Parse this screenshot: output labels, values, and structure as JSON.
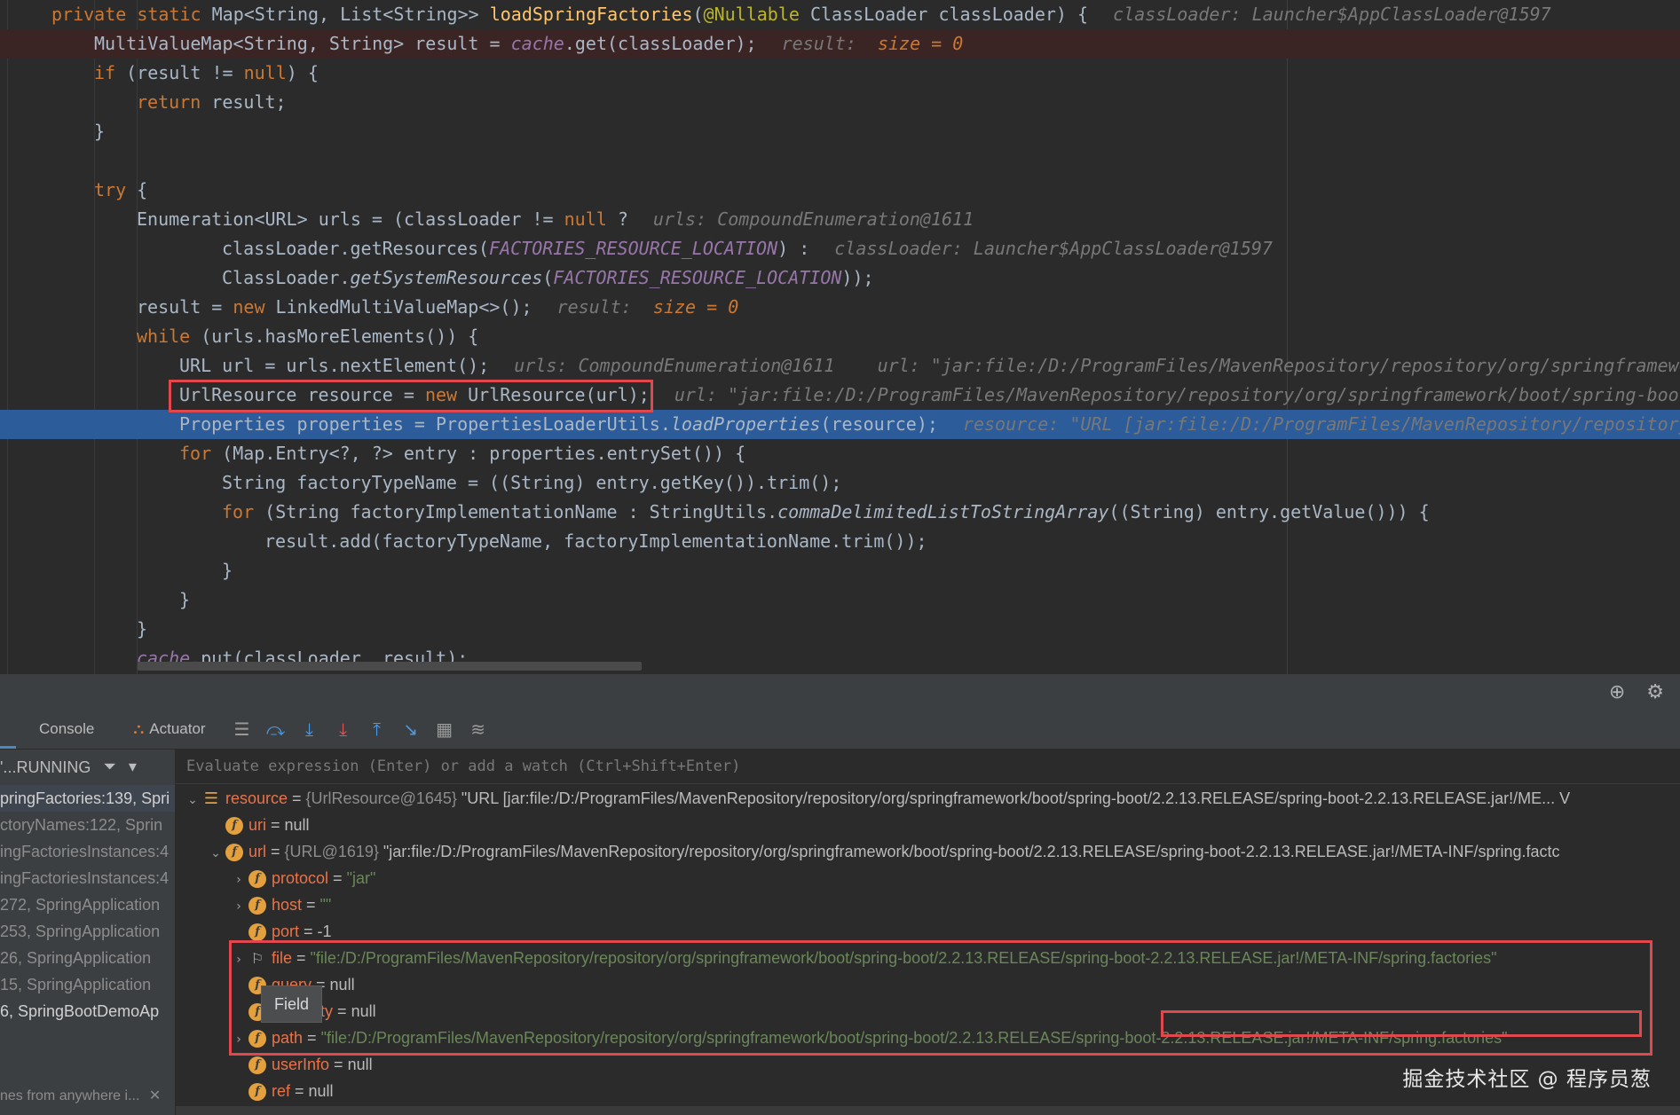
{
  "editor": {
    "lines": [
      {
        "segments": [
          [
            "kw",
            "private static "
          ],
          [
            "ty",
            "Map<String, List<String>> "
          ],
          [
            "fn",
            "loadSpringFactories"
          ],
          [
            "ty",
            "("
          ],
          [
            "an",
            "@Nullable "
          ],
          [
            "ty",
            "ClassLoader classLoader) {"
          ]
        ],
        "hint": "classLoader: Launcher$AppClassLoader@1597",
        "indent": 1
      },
      {
        "segments": [
          [
            "ty",
            "MultiValueMap<String, String> result = "
          ],
          [
            "st",
            "cache"
          ],
          [
            "ty",
            ".get(classLoader);"
          ]
        ],
        "hint": "result:  ",
        "hintVal": "size = 0",
        "indent": 2,
        "bp": true
      },
      {
        "segments": [
          [
            "kw",
            "if "
          ],
          [
            "ty",
            "(result != "
          ],
          [
            "kw",
            "null"
          ],
          [
            "ty",
            ") {"
          ]
        ],
        "indent": 2
      },
      {
        "segments": [
          [
            "kw",
            "return "
          ],
          [
            "ty",
            "result;"
          ]
        ],
        "indent": 3
      },
      {
        "segments": [
          [
            "ty",
            "}"
          ]
        ],
        "indent": 2
      },
      {
        "segments": [],
        "indent": 0
      },
      {
        "segments": [
          [
            "kw",
            "try "
          ],
          [
            "ty",
            "{"
          ]
        ],
        "indent": 2
      },
      {
        "segments": [
          [
            "ty",
            "Enumeration<URL> urls = (classLoader != "
          ],
          [
            "kw",
            "null "
          ],
          [
            "ty",
            "?"
          ]
        ],
        "hint": "urls: CompoundEnumeration@1611",
        "indent": 3
      },
      {
        "segments": [
          [
            "ty",
            "classLoader.getResources("
          ],
          [
            "st",
            "FACTORIES_RESOURCE_LOCATION"
          ],
          [
            "ty",
            ") :"
          ]
        ],
        "hint": "classLoader: Launcher$AppClassLoader@1597",
        "indent": 5
      },
      {
        "segments": [
          [
            "ty",
            "ClassLoader."
          ],
          [
            "it",
            "getSystemResources"
          ],
          [
            "ty",
            "("
          ],
          [
            "st",
            "FACTORIES_RESOURCE_LOCATION"
          ],
          [
            "ty",
            "));"
          ]
        ],
        "indent": 5
      },
      {
        "segments": [
          [
            "ty",
            "result = "
          ],
          [
            "kw",
            "new "
          ],
          [
            "ty",
            "LinkedMultiValueMap<>();"
          ]
        ],
        "hint": "result:  ",
        "hintVal": "size = 0",
        "indent": 3
      },
      {
        "segments": [
          [
            "kw",
            "while "
          ],
          [
            "ty",
            "(urls.hasMoreElements()) {"
          ]
        ],
        "indent": 3
      },
      {
        "segments": [
          [
            "ty",
            "URL url = urls.nextElement();"
          ]
        ],
        "hint": "urls: CompoundEnumeration@1611    url: \"jar:file:/D:/ProgramFiles/MavenRepository/repository/org/springframework",
        "indent": 4
      },
      {
        "segments": [
          [
            "ty",
            "UrlResource resource = "
          ],
          [
            "kw",
            "new "
          ],
          [
            "ty",
            "UrlResource(url);"
          ]
        ],
        "hint": "url: \"jar:file:/D:/ProgramFiles/MavenRepository/repository/org/springframework/boot/spring-boot",
        "indent": 4
      },
      {
        "segments": [
          [
            "ty",
            "Properties properties = PropertiesLoaderUtils."
          ],
          [
            "it",
            "loadProperties"
          ],
          [
            "ty",
            "(resource);"
          ]
        ],
        "hint": "resource: \"URL [jar:file:/D:/ProgramFiles/MavenRepository/repository",
        "indent": 4,
        "cur": true
      },
      {
        "segments": [
          [
            "kw",
            "for "
          ],
          [
            "ty",
            "(Map.Entry<?, ?> entry : properties.entrySet()) {"
          ]
        ],
        "indent": 4
      },
      {
        "segments": [
          [
            "ty",
            "String factoryTypeName = ((String) entry.getKey()).trim();"
          ]
        ],
        "indent": 5
      },
      {
        "segments": [
          [
            "kw",
            "for "
          ],
          [
            "ty",
            "(String factoryImplementationName : StringUtils."
          ],
          [
            "it",
            "commaDelimitedListToStringArray"
          ],
          [
            "ty",
            "((String) entry.getValue())) {"
          ]
        ],
        "indent": 5
      },
      {
        "segments": [
          [
            "ty",
            "result.add(factoryTypeName, factoryImplementationName.trim());"
          ]
        ],
        "indent": 6
      },
      {
        "segments": [
          [
            "ty",
            "}"
          ]
        ],
        "indent": 5
      },
      {
        "segments": [
          [
            "ty",
            "}"
          ]
        ],
        "indent": 4
      },
      {
        "segments": [
          [
            "ty",
            "}"
          ]
        ],
        "indent": 3
      },
      {
        "segments": [
          [
            "st",
            "cache"
          ],
          [
            "ty",
            ".put(classLoader, result);"
          ]
        ],
        "indent": 3
      }
    ]
  },
  "debug": {
    "tabs": {
      "console": "Console",
      "actuator": "Actuator"
    },
    "frames_header": "'...RUNNING",
    "frames": [
      "pringFactories:139, Spri",
      "ctoryNames:122, Sprin",
      "ingFactoriesInstances:4",
      "ingFactoriesInstances:4",
      "272, SpringApplication",
      "253, SpringApplication",
      "26, SpringApplication",
      "15, SpringApplication",
      "6, SpringBootDemoAp"
    ],
    "frames_footer": "nes from anywhere i...",
    "eval_placeholder": "Evaluate expression (Enter) or add a watch (Ctrl+Shift+Enter)",
    "variables": [
      {
        "arrow": "v",
        "icon": "list",
        "name": "resource",
        "type": "{UrlResource@1645} ",
        "value": "\"URL [jar:file:/D:/ProgramFiles/MavenRepository/repository/org/springframework/boot/spring-boot/2.2.13.RELEASE/spring-boot-2.2.13.RELEASE.jar!/ME... V",
        "kind": "plain",
        "depth": 0
      },
      {
        "arrow": "",
        "icon": "f",
        "name": "uri",
        "type": "",
        "value": "null",
        "kind": "plain",
        "depth": 1
      },
      {
        "arrow": "v",
        "icon": "f",
        "name": "url",
        "type": "{URL@1619} ",
        "value": "\"jar:file:/D:/ProgramFiles/MavenRepository/repository/org/springframework/boot/spring-boot/2.2.13.RELEASE/spring-boot-2.2.13.RELEASE.jar!/META-INF/spring.factc",
        "kind": "plain",
        "depth": 1
      },
      {
        "arrow": ">",
        "icon": "f",
        "name": "protocol",
        "type": "",
        "value": "\"jar\"",
        "kind": "str",
        "depth": 2
      },
      {
        "arrow": ">",
        "icon": "f",
        "name": "host",
        "type": "",
        "value": "\"\"",
        "kind": "str",
        "depth": 2
      },
      {
        "arrow": "",
        "icon": "f",
        "name": "port",
        "type": "",
        "value": "-1",
        "kind": "plain",
        "depth": 2
      },
      {
        "arrow": ">",
        "icon": "flag",
        "name": "file",
        "type": "",
        "value": "\"file:/D:/ProgramFiles/MavenRepository/repository/org/springframework/boot/spring-boot/2.2.13.RELEASE/spring-boot-2.2.13.RELEASE.jar!/META-INF/spring.factories\"",
        "kind": "str",
        "depth": 2
      },
      {
        "arrow": "",
        "icon": "f",
        "name": "query",
        "type": "",
        "value": "null",
        "kind": "plain",
        "depth": 2
      },
      {
        "arrow": "",
        "icon": "f",
        "name": "authority",
        "type": "",
        "value": "null",
        "kind": "plain",
        "depth": 2
      },
      {
        "arrow": ">",
        "icon": "f",
        "name": "path",
        "type": "",
        "value": "\"file:/D:/ProgramFiles/MavenRepository/repository/org/springframework/boot/spring-boot/2.2.13.RELEASE/spring-boot-2.2.13.RELEASE.jar!/META-INF/spring.factories\"",
        "kind": "str",
        "depth": 2
      },
      {
        "arrow": "",
        "icon": "f",
        "name": "userInfo",
        "type": "",
        "value": "null",
        "kind": "plain",
        "depth": 2
      },
      {
        "arrow": "",
        "icon": "f",
        "name": "ref",
        "type": "",
        "value": "null",
        "kind": "plain",
        "depth": 2
      }
    ],
    "tooltip": "Field",
    "watermark": "掘金技术社区 @ 程序员葱"
  },
  "colors": {
    "accent": "#2d5c9a",
    "highlight_box": "#e0484e"
  }
}
